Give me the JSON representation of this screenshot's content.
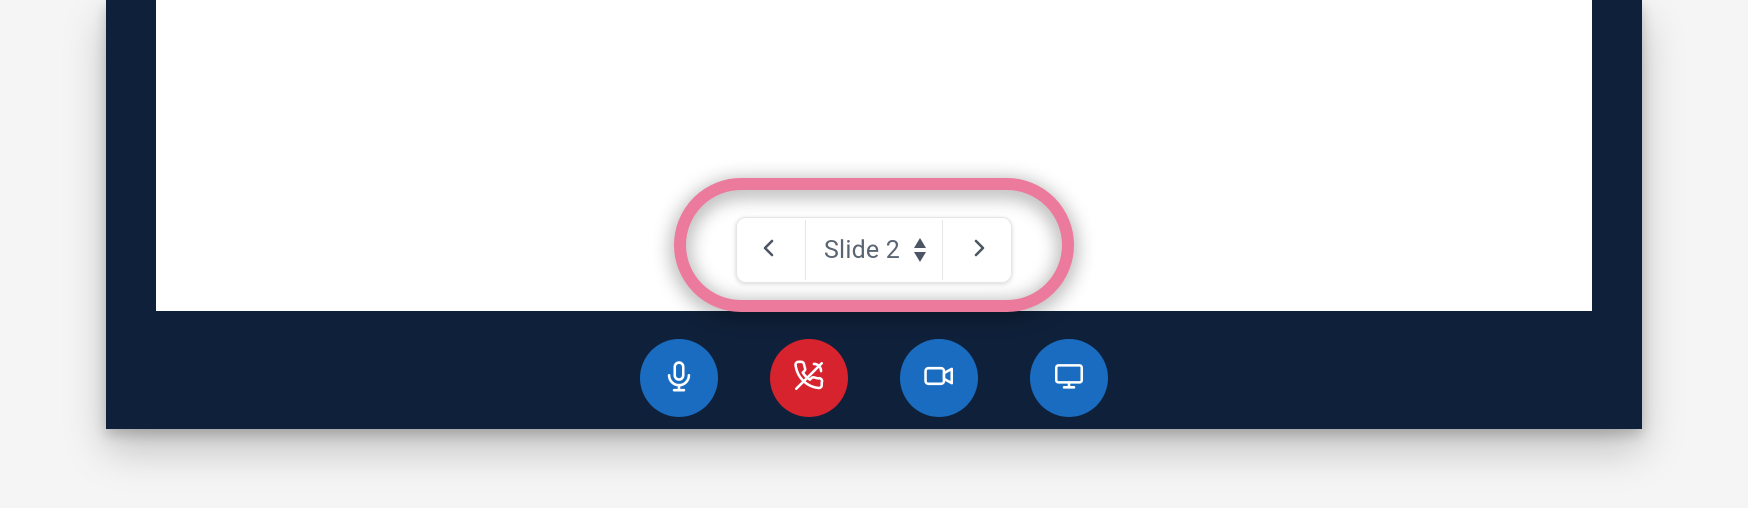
{
  "slide_nav": {
    "current_label": "Slide 2"
  },
  "toolbar": {
    "mic": "mic",
    "hangup": "hangup",
    "camera": "camera",
    "screen": "screen"
  },
  "colors": {
    "accent_blue": "#1a6cc0",
    "accent_red": "#d6232e",
    "highlight_pink": "#ec7a9c",
    "frame_navy": "#0f213a"
  }
}
